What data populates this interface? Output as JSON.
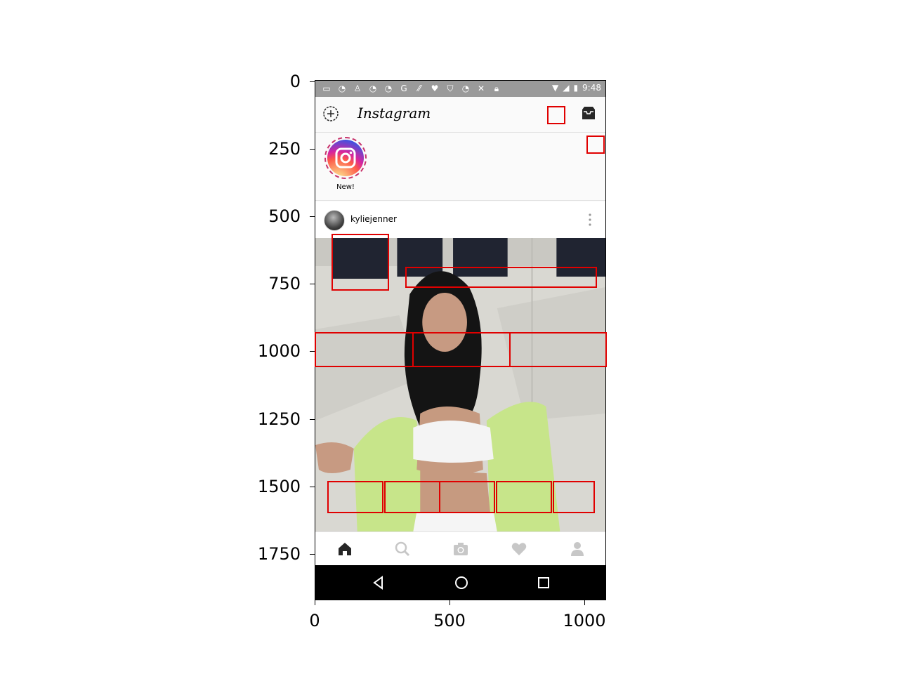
{
  "axes": {
    "y_ticks": [
      "0",
      "250",
      "500",
      "750",
      "1000",
      "1250",
      "1500",
      "1750"
    ],
    "x_ticks": [
      "0",
      "500",
      "1000"
    ]
  },
  "status_bar": {
    "time": "9:48",
    "left_icons": [
      "message-icon",
      "steam-icon",
      "person-icon",
      "steam-icon",
      "steam-icon",
      "google-icon",
      "f1-icon",
      "heart-icon",
      "shield-icon",
      "steam-icon",
      "tools-icon",
      "lock-icon"
    ],
    "right_icons": [
      "wifi-icon",
      "signal-icon",
      "battery-icon"
    ]
  },
  "app_bar": {
    "logo_text": "Instagram",
    "left_icon": "add-story-icon",
    "right_icon": "inbox-icon"
  },
  "stories": [
    {
      "label": "New!"
    }
  ],
  "post": {
    "username": "kyliejenner"
  },
  "bottom_nav": [
    "home-icon",
    "search-icon",
    "camera-icon",
    "heart-icon",
    "profile-icon"
  ],
  "android_nav": [
    "back-icon",
    "home-circle-icon",
    "recents-icon"
  ],
  "colors": {
    "status_bar": "#9a9a9a",
    "annotation": "#e00000",
    "gradient_story": [
      "#fdf497",
      "#fd5949",
      "#d6249f",
      "#285AEB"
    ],
    "active_nav": "#262626",
    "inactive_nav": "#c7c7c7"
  }
}
